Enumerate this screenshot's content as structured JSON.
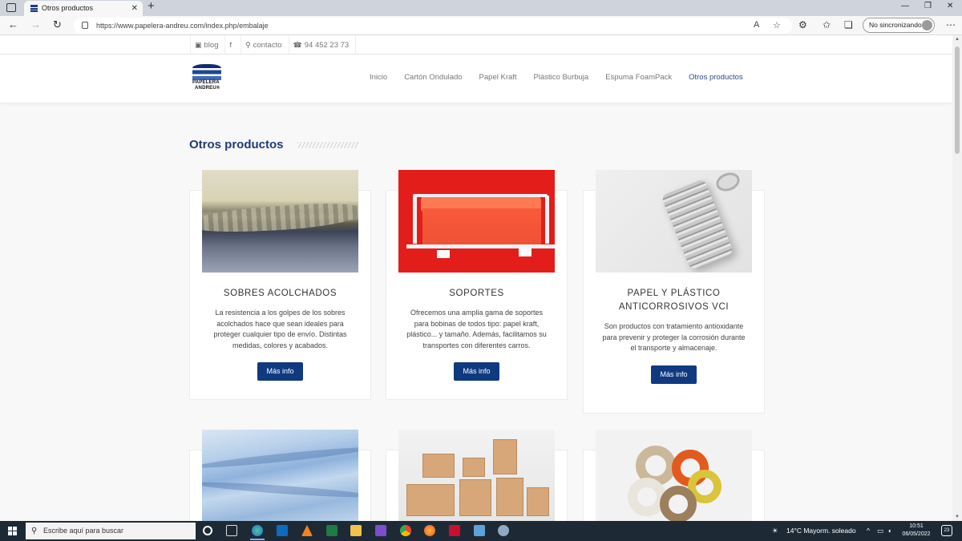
{
  "browser": {
    "tab_title": "Otros productos",
    "url": "https://www.papelera-andreu.com/index.php/embalaje",
    "profile_label": "No sincronizando"
  },
  "topbar": {
    "blog": "blog",
    "contacto": "contacto",
    "phone": "94 452 23 73"
  },
  "logo": {
    "line1": "PAPELERA",
    "line2": "ANDREU®"
  },
  "nav": {
    "items": [
      {
        "label": "Inicio"
      },
      {
        "label": "Cartón Ondulado"
      },
      {
        "label": "Papel Kraft"
      },
      {
        "label": "Plástico Burbuja"
      },
      {
        "label": "Espuma FoamPack"
      },
      {
        "label": "Otros productos"
      }
    ],
    "active_index": 5
  },
  "section": {
    "title": "Otros productos"
  },
  "cards": [
    {
      "title": "SOBRES ACOLCHADOS",
      "description": "La resistencia a los golpes de los sobres acolchados hace que sean ideales para proteger cualquier tipo de envío. Distintas medidas, colores y acabados.",
      "button": "Más info"
    },
    {
      "title": "SOPORTES",
      "description": "Ofrecemos una amplia gama de soportes para bobinas de todos tipo: papel kraft, plástico... y tamaño. Además, facilitamos su transportes con diferentes carros.",
      "button": "Más info"
    },
    {
      "title_line1": "PAPEL Y PLÁSTICO",
      "title_line2": "ANTICORROSIVOS VCI",
      "description": "Son productos con tratamiento antioxidante para prevenir y proteger la corrosión durante el transporte y almacenaje.",
      "button": "Más info"
    }
  ],
  "taskbar": {
    "search_placeholder": "Escribe aquí para buscar",
    "weather": "14°C  Mayorm. soleado",
    "time": "10:51",
    "date": "06/05/2022",
    "notifications": "23"
  },
  "colors": {
    "brand_blue": "#0f3a80",
    "title_blue": "#1f3b76",
    "taskbar": "#1d2a36"
  }
}
